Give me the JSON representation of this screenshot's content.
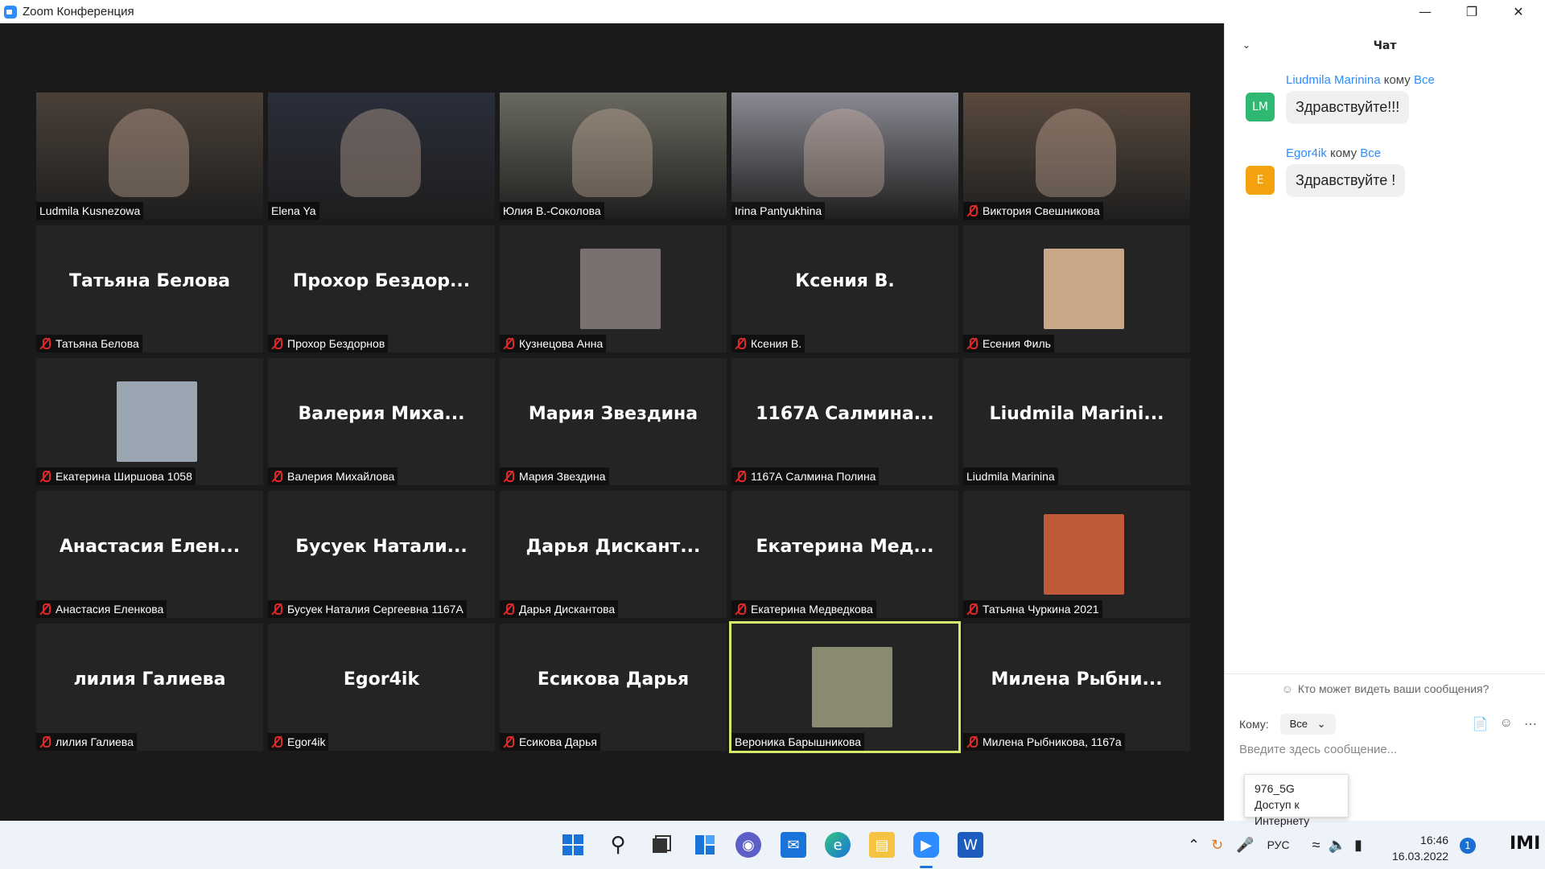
{
  "window": {
    "title": "Zoom Конференция"
  },
  "tiles": [
    {
      "name": "Ludmila Kusnezowa",
      "big": "",
      "muted": false,
      "video": true,
      "bg": "#4a4038"
    },
    {
      "name": "Elena Ya",
      "big": "",
      "muted": false,
      "video": true,
      "bg": "#2a2e3a"
    },
    {
      "name": "Юлия В.-Соколова",
      "big": "",
      "muted": false,
      "video": true,
      "bg": "#6a6a60"
    },
    {
      "name": "Irina Pantyukhina",
      "big": "",
      "muted": false,
      "video": true,
      "bg": "#8a8a94"
    },
    {
      "name": "Виктория Свешникова",
      "big": "",
      "muted": true,
      "video": true,
      "bg": "#5a4a3e"
    },
    {
      "name": "Татьяна Белова",
      "big": "Татьяна Белова",
      "muted": true
    },
    {
      "name": "Прохор Бездорнов",
      "big": "Прохор Бездор...",
      "muted": true
    },
    {
      "name": "Кузнецова Анна",
      "big": "",
      "muted": true,
      "avatar": "#7a7070"
    },
    {
      "name": "Ксения В.",
      "big": "Ксения В.",
      "muted": true
    },
    {
      "name": "Есения Филь",
      "big": "",
      "muted": true,
      "avatar": "#c9a88a"
    },
    {
      "name": "Екатерина Ширшова 1058",
      "big": "",
      "muted": true,
      "avatar": "#9aa7b2"
    },
    {
      "name": "Валерия Михайлова",
      "big": "Валерия  Миха...",
      "muted": true
    },
    {
      "name": "Мария Звездина",
      "big": "Мария Звездина",
      "muted": true
    },
    {
      "name": "1167А Салмина Полина",
      "big": "1167А  Салмина...",
      "muted": true
    },
    {
      "name": "Liudmila Marinina",
      "big": "Liudmila  Marini...",
      "muted": false
    },
    {
      "name": "Анастасия Еленкова",
      "big": "Анастасия  Елен...",
      "muted": true
    },
    {
      "name": "Бусуек Наталия Сергеевна 1167А",
      "big": "Бусуек  Натали...",
      "muted": true
    },
    {
      "name": "Дарья Дискантова",
      "big": "Дарья Дискант...",
      "muted": true
    },
    {
      "name": "Екатерина Медведкова",
      "big": "Екатерина  Мед...",
      "muted": true
    },
    {
      "name": "Татьяна Чуркина 2021",
      "big": "",
      "muted": true,
      "avatar": "#c05a3a"
    },
    {
      "name": "лилия Галиева",
      "big": "лилия Галиева",
      "muted": true
    },
    {
      "name": "Egor4ik",
      "big": "Egor4ik",
      "muted": true
    },
    {
      "name": "Есикова Дарья",
      "big": "Есикова Дарья",
      "muted": true
    },
    {
      "name": "Вероника Барышникова",
      "big": "",
      "muted": false,
      "avatar": "#8a8a70",
      "active": true
    },
    {
      "name": "Милена Рыбникова, 1167а",
      "big": "Милена  Рыбни...",
      "muted": true
    }
  ],
  "chat": {
    "title": "Чат",
    "messages": [
      {
        "initials": "LM",
        "color": "#2eb872",
        "sender": "Liudmila Marinina",
        "to_word": "кому",
        "to": "Все",
        "text": "Здравствуйте!!!"
      },
      {
        "initials": "E",
        "color": "#f5a20f",
        "sender": "Egor4ik",
        "to_word": "кому",
        "to": "Все",
        "text": "Здравствуйте !"
      }
    ],
    "who_can_see": "Кто может видеть ваши сообщения?",
    "to_label": "Кому:",
    "to_value": "Все",
    "input_placeholder": "Введите здесь сообщение..."
  },
  "tooltip": {
    "network": "976_5G",
    "status": "Доступ к Интернету"
  },
  "taskbar": {
    "lang": "РУС",
    "time": "16:46",
    "date": "16.03.2022",
    "notifications": "1"
  }
}
